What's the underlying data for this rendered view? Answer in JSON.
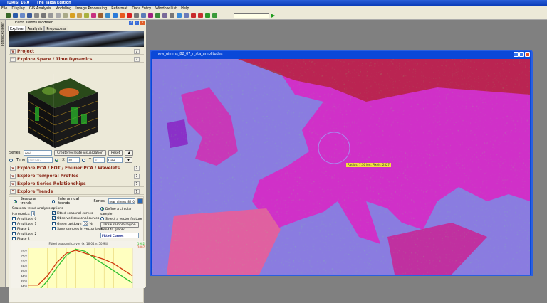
{
  "app": {
    "title": "IDRISI 16.0",
    "edition": "The Taiga Edition"
  },
  "menu": [
    "File",
    "Display",
    "GIS Analysis",
    "Modeling",
    "Image Processing",
    "Reformat",
    "Data Entry",
    "Window List",
    "Help"
  ],
  "toolbar": {
    "icon_colors": [
      "#3a6a2a",
      "#2a5aa8",
      "#6a8ac8",
      "#3a5a9a",
      "#888",
      "#777",
      "#999",
      "#aaa",
      "#aa8",
      "#d8a020",
      "#c8a050",
      "#a8b040",
      "#c83080",
      "#a06030",
      "#3a8ac8",
      "#2a7ad8",
      "#e85a20",
      "#d82020",
      "#777",
      "#5a7ab8",
      "#a02080",
      "#3a8a3a",
      "#7a6a9a",
      "#777",
      "#3a8ad8",
      "#6a7ab8",
      "#c82a2a",
      "#c83030",
      "#2a9a2a",
      "#3a9a3a"
    ],
    "dropdown_value": "",
    "run_icon": "play-icon"
  },
  "left_panel": {
    "vertical_tab": "IdrisiExplorer",
    "title": "Earth Trends Modeler",
    "tabs": [
      "Explore",
      "Analysis",
      "Preprocess"
    ],
    "sections": {
      "project": "Project",
      "space_time": "Explore Space / Time Dynamics",
      "pca": "Explore PCA / EOT / Fourier PCA / Wavelets",
      "profiles": "Explore Temporal Profiles",
      "relationships": "Explore Series Relationships",
      "trends": "Explore Trends"
    },
    "help_label": "?",
    "series_label": "Series:",
    "series_value": "ndvi",
    "create_btn": "Create/recreate visualization",
    "reset_btn": "Reset",
    "time_label": "Time",
    "time_value": "Jan/1982",
    "x_label": "X",
    "x_value": "28",
    "y_label": "Y",
    "y_value": "30",
    "shape_value": "Cube",
    "trends": {
      "seasonal": "Seasonal trends",
      "interannual": "Interannual trends",
      "series_label": "Series:",
      "series_value": "new_gimms_82_0",
      "options_title": "Seasonal trend analysis options",
      "harmonics_label": "Harmonics:",
      "harmonics_value": "2",
      "checks": [
        "Amplitude 0",
        "Amplitude 1",
        "Phase 1",
        "Amplitude 2",
        "Phase 2"
      ],
      "fitted": "Fitted seasonal curves",
      "observed": "Observed seasonal curves",
      "green": "Green up/down",
      "green_value": "50",
      "green_unit": "%",
      "save": "Save samples in vector layer",
      "circular": "Define a circular sample",
      "vector": "Select a vector feature",
      "draw_btn": "Draw sample region",
      "graph_label": "Trend to graph:",
      "graph_value": "Fitted Curves"
    }
  },
  "chart_data": {
    "type": "line",
    "title": "Fitted seasonal curves (x: 16.04  y: 50.94)",
    "x": [
      1,
      2,
      3,
      4,
      5,
      6,
      7,
      8,
      9,
      10,
      11,
      12
    ],
    "yticks": [
      6900,
      6400,
      5900,
      5400,
      4900,
      4400,
      3900,
      3400
    ],
    "ylim": [
      3200,
      7100
    ],
    "grid": true,
    "series": [
      {
        "name": "1982",
        "color": "#30c030",
        "values": [
          2600,
          2900,
          3900,
          5200,
          6400,
          7000,
          6800,
          6100,
          5500,
          4900,
          4300,
          3700
        ]
      },
      {
        "name": "2007",
        "color": "#d03a10",
        "values": [
          3500,
          3500,
          4400,
          5700,
          6600,
          6900,
          6600,
          6300,
          6000,
          5600,
          5000,
          4400
        ]
      }
    ]
  },
  "map_window": {
    "title": "new_gimms_82_07_r_sta_amplitudes",
    "sample_label": "Radius: 7.36 km, Pixels: 2827"
  }
}
